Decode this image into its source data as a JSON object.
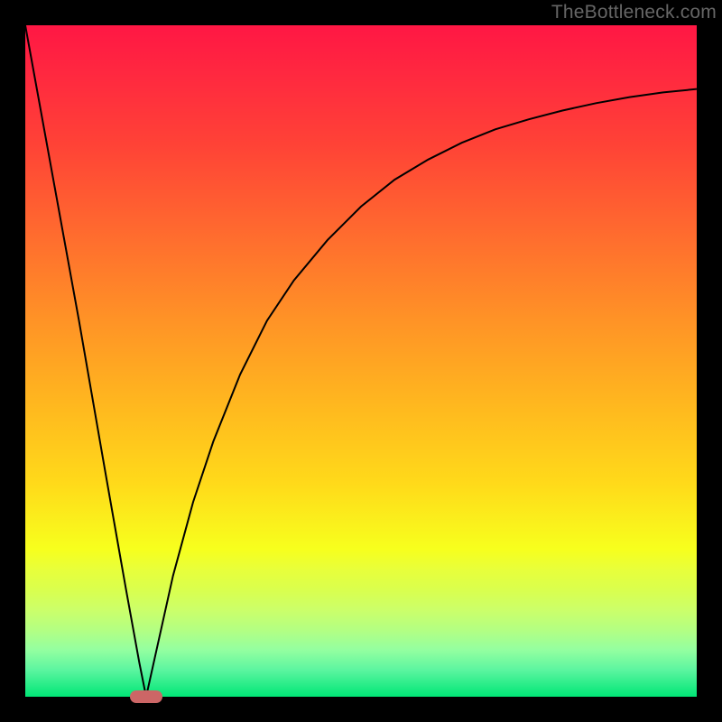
{
  "watermark": "TheBottleneck.com",
  "colors": {
    "frame": "#000000",
    "curve": "#000000",
    "blob": "#cc6666"
  },
  "chart_data": {
    "type": "line",
    "title": "",
    "xlabel": "",
    "ylabel": "",
    "xlim": [
      0,
      100
    ],
    "ylim": [
      0,
      100
    ],
    "grid": false,
    "series": [
      {
        "name": "left-branch",
        "x": [
          0,
          4,
          8,
          12,
          15,
          17,
          18
        ],
        "values": [
          100,
          78,
          56,
          33,
          16,
          5,
          0
        ]
      },
      {
        "name": "right-branch",
        "x": [
          18,
          20,
          22,
          25,
          28,
          32,
          36,
          40,
          45,
          50,
          55,
          60,
          65,
          70,
          75,
          80,
          85,
          90,
          95,
          100
        ],
        "values": [
          0,
          9,
          18,
          29,
          38,
          48,
          56,
          62,
          68,
          73,
          77,
          80,
          82.5,
          84.5,
          86,
          87.3,
          88.4,
          89.3,
          90,
          90.5
        ]
      }
    ],
    "marker": {
      "x": 18,
      "y": 0,
      "shape": "pill",
      "color": "#cc6666"
    }
  }
}
